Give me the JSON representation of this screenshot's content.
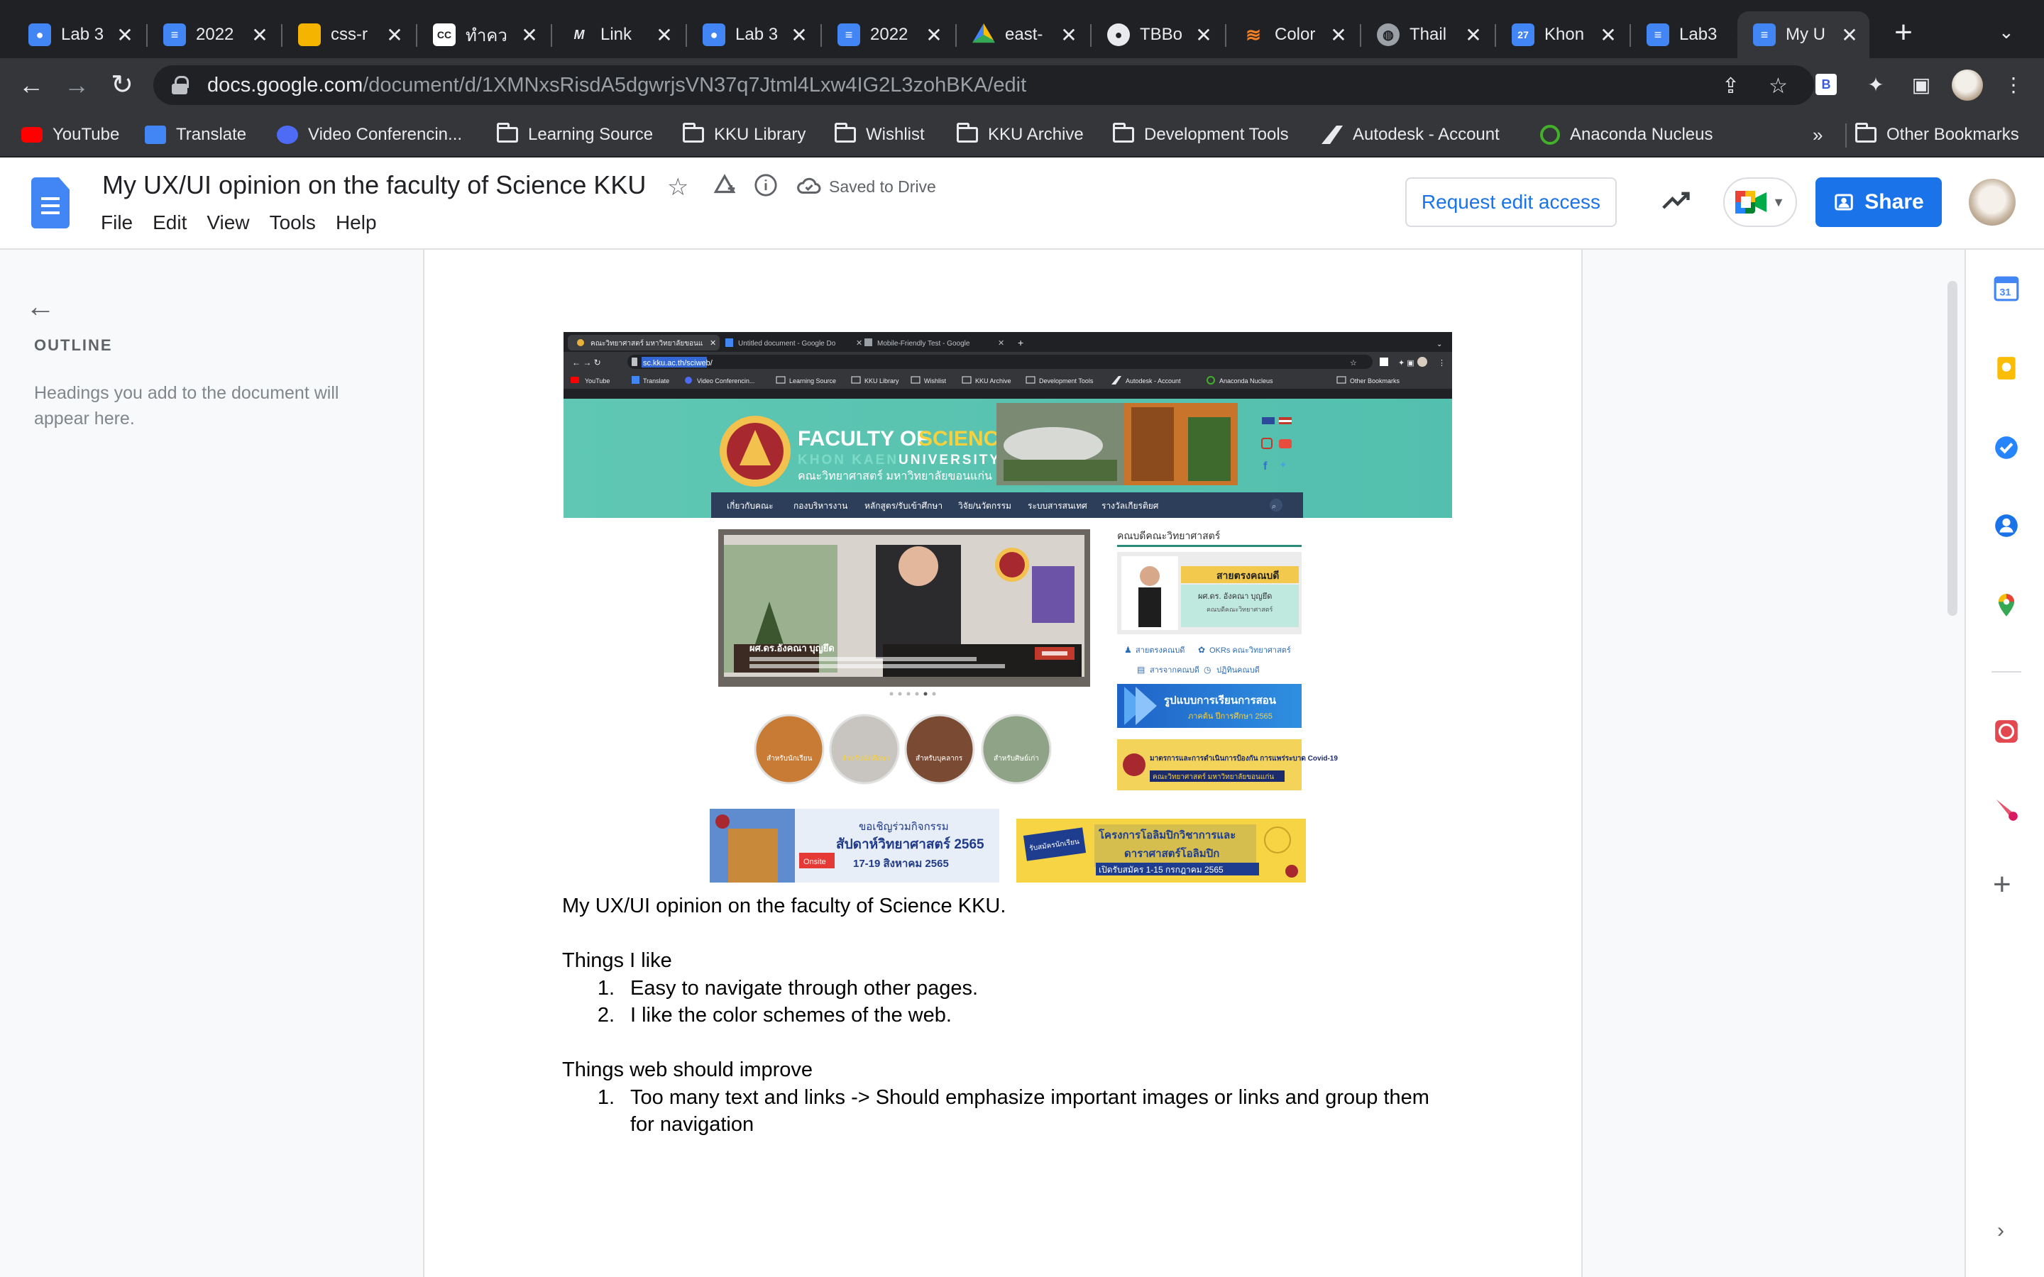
{
  "browser": {
    "tabs": [
      {
        "title": "Lab 3",
        "favicon": "user-icon",
        "color": "#4285f4",
        "active": false
      },
      {
        "title": "2022",
        "favicon": "docs-icon",
        "color": "#4285f4",
        "active": false
      },
      {
        "title": "css-r",
        "favicon": "slides-icon",
        "color": "#f4b400",
        "active": false
      },
      {
        "title": "ทำคว",
        "favicon": "cc-icon",
        "color": "#ffffff",
        "active": false
      },
      {
        "title": "Link",
        "favicon": "m-icon",
        "color": "#202124",
        "active": false
      },
      {
        "title": "Lab 3",
        "favicon": "user-icon",
        "color": "#4285f4",
        "active": false
      },
      {
        "title": "2022",
        "favicon": "docs-icon",
        "color": "#4285f4",
        "active": false
      },
      {
        "title": "east-",
        "favicon": "drive-icon",
        "color": "#34a853",
        "active": false
      },
      {
        "title": "TBBo",
        "favicon": "github-icon",
        "color": "#202124",
        "active": false
      },
      {
        "title": "Color",
        "favicon": "stackoverflow-icon",
        "color": "#f48024",
        "active": false
      },
      {
        "title": "Thail",
        "favicon": "globe-icon",
        "color": "#9aa0a6",
        "active": false
      },
      {
        "title": "Khon",
        "favicon": "calendar-icon",
        "color": "#4285f4",
        "active": false
      },
      {
        "title": "Lab3",
        "favicon": "docs-icon",
        "color": "#4285f4",
        "active": false
      },
      {
        "title": "My U",
        "favicon": "docs-icon",
        "color": "#4285f4",
        "active": true
      }
    ],
    "url_domain": "docs.google.com",
    "url_path": "/document/d/1XMNxsRisdA5dgwrjsVN37q7Jtml4Lxw4IG2L3zohBKA/edit",
    "bookmarks": [
      {
        "label": "YouTube",
        "icon": "youtube-icon"
      },
      {
        "label": "Translate",
        "icon": "translate-icon"
      },
      {
        "label": "Video Conferencin...",
        "icon": "video-icon"
      },
      {
        "label": "Learning Source",
        "icon": "folder-icon"
      },
      {
        "label": "KKU Library",
        "icon": "folder-icon"
      },
      {
        "label": "Wishlist",
        "icon": "folder-icon"
      },
      {
        "label": "KKU Archive",
        "icon": "folder-icon"
      },
      {
        "label": "Development Tools",
        "icon": "folder-icon"
      },
      {
        "label": "Autodesk - Account",
        "icon": "autodesk-icon"
      },
      {
        "label": "Anaconda Nucleus",
        "icon": "anaconda-icon"
      }
    ],
    "bookmarks_overflow": "»",
    "other_bookmarks": "Other Bookmarks"
  },
  "docs": {
    "title": "My UX/UI opinion on the faculty of Science KKU",
    "saved_status": "Saved to Drive",
    "menu": [
      "File",
      "Edit",
      "View",
      "Tools",
      "Help"
    ],
    "request_edit": "Request edit access",
    "share": "Share"
  },
  "outline": {
    "heading": "OUTLINE",
    "placeholder": "Headings you add to the document will appear here."
  },
  "embedded_screenshot": {
    "tabs": [
      "คณะวิทยาศาสตร์ มหาวิทยาลัยขอนแ",
      "Untitled document - Google Do",
      "Mobile-Friendly Test - Google"
    ],
    "url": "sc.kku.ac.th/sciweb/",
    "bookmarks": [
      "YouTube",
      "Translate",
      "Video Conferencin...",
      "Learning Source",
      "KKU Library",
      "Wishlist",
      "KKU Archive",
      "Development Tools",
      "Autodesk - Account",
      "Anaconda Nucleus",
      "Other Bookmarks"
    ],
    "faculty_line1": "FACULTY OF",
    "faculty_line1b": "SCIENCE",
    "faculty_line2a": "KHON KAEN",
    "faculty_line2b": "UNIVERSITY",
    "faculty_thai": "คณะวิทยาศาสตร์ มหาวิทยาลัยขอนแก่น",
    "nav": [
      "เกี่ยวกับคณะ",
      "กองบริหารงาน",
      "หลักสูตร/รับเข้าศึกษา",
      "วิจัย/นวัตกรรม",
      "ระบบสารสนเทศ",
      "รางวัลเกียรติยศ"
    ],
    "dean_heading": "คณบดีคณะวิทยาศาสตร์",
    "dean_hotline": "สายตรงคณบดี",
    "dean_name": "ผศ.ดร. อังคณา บุญยึด",
    "dean_role": "คณบดีคณะวิทยาศาสตร์",
    "banner_name": "ผศ.ดร.อังคณา บุญยึด",
    "links": [
      "สายตรงคณบดี",
      "OKRs คณะวิทยาศาสตร์",
      "สารจากคณบดี",
      "ปฏิทินคณบดี"
    ],
    "study_banner_title": "รูปแบบการเรียนการสอน",
    "study_banner_sub": "ภาคต้น ปีการศึกษา 2565",
    "covid_banner": "มาตรการและการดำเนินการป้องกัน การแพร่ระบาด Covid-19",
    "covid_banner_sub": "คณะวิทยาศาสตร์ มหาวิทยาลัยขอนแก่น",
    "circles": [
      "สำหรับนักเรียน",
      "สำหรับนักศึกษา",
      "สำหรับบุคลากร",
      "สำหรับศิษย์เก่า"
    ],
    "promo1_title": "ขอเชิญร่วมกิจกรรม",
    "promo1_event": "สัปดาห์วิทยาศาสตร์ 2565",
    "promo1_date": "17-19 สิงหาคม 2565",
    "promo1_tag": "Onsite",
    "promo2_line1": "โครงการโอลิมปิกวิชาการและ",
    "promo2_line2": "ดาราศาสตร์โอลิมปิก",
    "promo2_date": "เปิดรับสมัคร 1-15 กรกฎาคม 2565",
    "promo2_tag": "รับสมัครนักเรียน"
  },
  "document": {
    "line1": "My UX/UI opinion on the faculty of Science KKU.",
    "like_heading": "Things I like",
    "likes": [
      "Easy to navigate through other pages.",
      "I like the color schemes of the web."
    ],
    "improve_heading": "Things web should improve",
    "improvements": [
      "Too many text and links -> Should emphasize important images or links and group them for navigation"
    ]
  }
}
